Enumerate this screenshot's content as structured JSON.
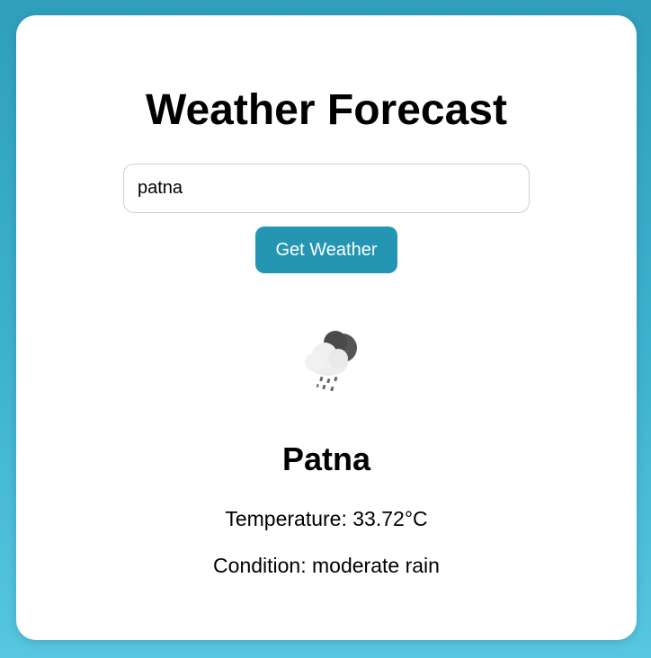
{
  "app": {
    "title": "Weather Forecast"
  },
  "search": {
    "value": "patna",
    "button_label": "Get Weather"
  },
  "result": {
    "icon": "moon-cloud-rain-icon",
    "city": "Patna",
    "temperature_label": "Temperature:",
    "temperature_value": "33.72°C",
    "condition_label": "Condition:",
    "condition_value": "moderate rain"
  },
  "colors": {
    "background_top": "#2f9fbd",
    "background_bottom": "#58c6e0",
    "button": "#2496b3",
    "card": "#ffffff"
  }
}
